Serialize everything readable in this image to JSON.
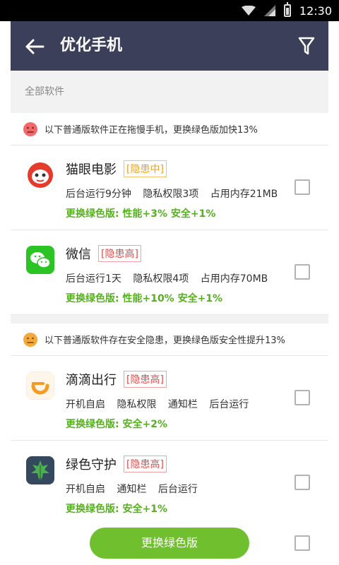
{
  "status_bar": {
    "time": "12:30"
  },
  "header": {
    "title": "优化手机"
  },
  "category_label": "全部软件",
  "sections": [
    {
      "notice": "以下普通版软件正在拖慢手机，更换绿色版加快13%",
      "apps": [
        {
          "name": "猫眼电影",
          "risk": "[隐患中]",
          "details": [
            "后台运行9分钟",
            "隐私权限3项",
            "占用内存21MB"
          ],
          "benefit": "更换绿色版: 性能+3% 安全+1%"
        },
        {
          "name": "微信",
          "risk": "[隐患高]",
          "details": [
            "后台运行1天",
            "隐私权限4项",
            "占用内存70MB"
          ],
          "benefit": "更换绿色版: 性能+10% 安全+1%"
        }
      ]
    },
    {
      "notice": "以下普通版软件存在安全隐患，更换绿色版安全性提升13%",
      "apps": [
        {
          "name": "滴滴出行",
          "risk": "[隐患高]",
          "details": [
            "开机自启",
            "隐私权限",
            "通知栏",
            "后台运行"
          ],
          "benefit": "更换绿色版: 安全+2%"
        },
        {
          "name": "绿色守护",
          "risk": "[隐患高]",
          "details": [
            "开机自启",
            "通知栏",
            "后台运行"
          ],
          "benefit": "更换绿色版: 安全+1%"
        }
      ]
    }
  ],
  "footer": {
    "button_label": "更换绿色版"
  },
  "colors": {
    "header_bg": "#3b3f5a",
    "green": "#56b020",
    "button_green": "#6fbf2f",
    "risk_mid": "#f0a21a",
    "risk_high": "#e24b4b",
    "face_red": "#f06a6a",
    "face_orange": "#f4a93a"
  }
}
